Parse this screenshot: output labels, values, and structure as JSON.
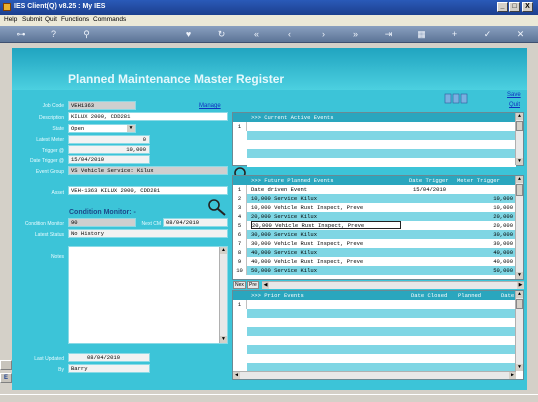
{
  "window": {
    "title": "IES Client(Q) v8.25 : My IES",
    "minimize": "_",
    "maximize": "□",
    "close": "X"
  },
  "menu": [
    "Help",
    "Submit",
    "Quit",
    "Functions",
    "Commands"
  ],
  "toolbar": {
    "icons": [
      "key-icon",
      "help-icon",
      "search-icon",
      "heart-icon",
      "refresh-icon",
      "rewind-icon",
      "previous-icon",
      "next-icon",
      "fast-forward-icon",
      "end-icon",
      "grid-icon",
      "add-icon",
      "confirm-icon",
      "close-icon"
    ]
  },
  "page": {
    "title": "Planned Maintenance Master Register",
    "manage_link": "Manage",
    "save_link": "Save",
    "quit_link": "Quit"
  },
  "form": {
    "job_code_label": "Job Code",
    "job_code": "VEH1363",
    "description_label": "Description",
    "description": "KILUX 2000, CDD281",
    "state_label": "State",
    "state": "Open",
    "latest_meter_label": "Latest Meter",
    "latest_meter": "0",
    "trigger_label": "Trigger @",
    "trigger": "10,000",
    "date_trigger_label": "Date Trigger @",
    "date_trigger": "15/04/2010",
    "event_group_label": "Event Group",
    "event_group": "VS Vehicle Service: Kilux",
    "asset_label": "Asset",
    "asset": "VEH-1363 KILUX 2000, CDD281",
    "condition_heading": "Condition Monitor: -",
    "condition_monitor_label": "Condition Monitor",
    "condition_monitor": "90",
    "next_cm_label": "Next CM",
    "next_cm": "08/04/2010",
    "latest_status_label": "Latest Status",
    "latest_status": "No History",
    "notes_label": "Notes",
    "last_updated_label": "Last Updated",
    "last_updated": "08/04/2010",
    "by_label": "By",
    "by": "Barry"
  },
  "current_events": {
    "header": ">>> Current Active Events",
    "rows": [
      {
        "num": "1",
        "text": ""
      }
    ]
  },
  "future_events": {
    "header": ">>> Future Planned Events",
    "col_date": "Date Trigger",
    "col_meter": "Meter Trigger",
    "rows": [
      {
        "num": "1",
        "event": "Date driven Event",
        "date": "15/04/2010",
        "meter": ""
      },
      {
        "num": "2",
        "event": "10,000 Service Kilux",
        "date": "",
        "meter": "10,000"
      },
      {
        "num": "3",
        "event": "10,000 Vehicle Rust Inspect, Preve",
        "date": "",
        "meter": "10,000"
      },
      {
        "num": "4",
        "event": "20,000 Service Kilux",
        "date": "",
        "meter": "20,000"
      },
      {
        "num": "5",
        "event": "20,000 Vehicle Rust Inspect, Preve",
        "date": "",
        "meter": "20,000"
      },
      {
        "num": "6",
        "event": "30,000 Service Kilux",
        "date": "",
        "meter": "30,000"
      },
      {
        "num": "7",
        "event": "30,000 Vehicle Rust Inspect, Preve",
        "date": "",
        "meter": "30,000"
      },
      {
        "num": "8",
        "event": "40,000 Service Kilux",
        "date": "",
        "meter": "40,000"
      },
      {
        "num": "9",
        "event": "40,000 Vehicle Rust Inspect, Preve",
        "date": "",
        "meter": "40,000"
      },
      {
        "num": "10",
        "event": "50,000 Service Kilux",
        "date": "",
        "meter": "50,000"
      }
    ],
    "nav": [
      "Nex",
      "Pre"
    ]
  },
  "prior_events": {
    "header": ">>> Prior Events",
    "col_closed": "Date Closed",
    "col_planned": "Planned",
    "col_date": "Date",
    "rows": [
      {
        "num": "1",
        "text": ""
      }
    ]
  }
}
